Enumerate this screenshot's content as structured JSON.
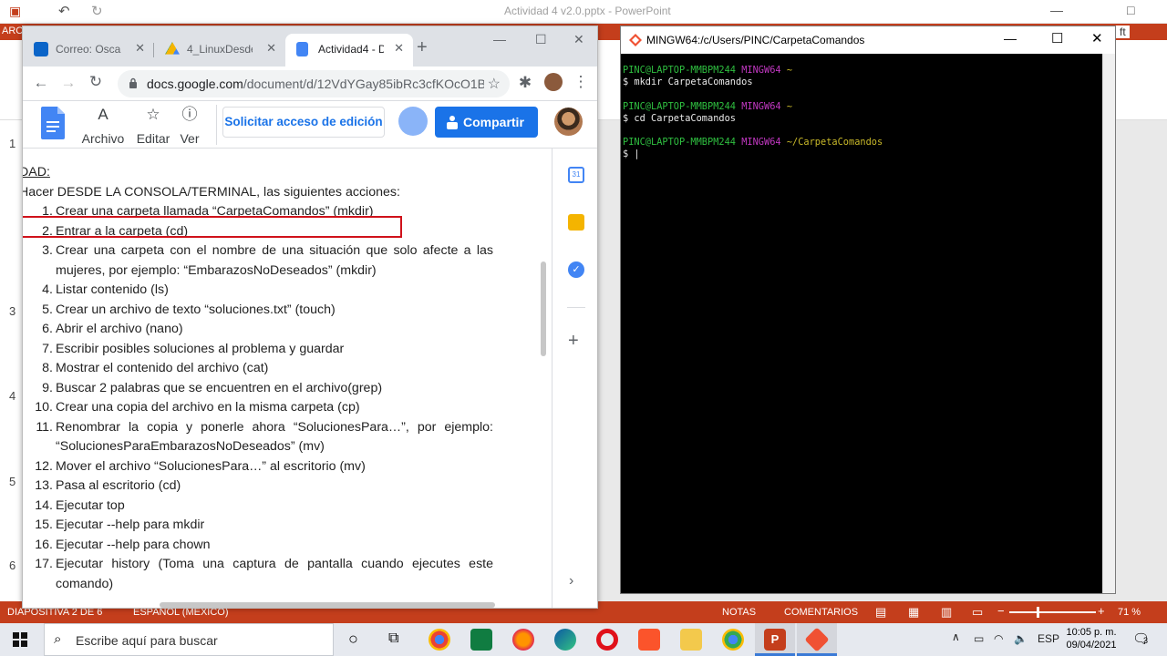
{
  "powerpoint": {
    "title": "Actividad 4 v2.0.pptx  -  PowerPoint",
    "ribbon_tab": "ARC",
    "right_fragment": "ft",
    "slide_numbers": [
      "1",
      "3",
      "4",
      "5",
      "6"
    ],
    "status": {
      "slide": "DIAPOSITIVA 2 DE 6",
      "language": "ESPAÑOL (MÉXICO)",
      "notes": "NOTAS",
      "comments": "COMENTARIOS",
      "zoom": "71 %"
    },
    "colors": {
      "accent": "#c43e1c"
    }
  },
  "chrome": {
    "tabs": [
      {
        "label": "Correo: Oscar S",
        "icon": "outlook-icon",
        "color": "#0a64c8"
      },
      {
        "label": "4_LinuxDesdeLa",
        "icon": "google-drive-icon",
        "color": "#f4b400"
      },
      {
        "label": "Actividad4 - Do",
        "icon": "google-docs-icon",
        "color": "#4285f4"
      }
    ],
    "url_host": "docs.google.com",
    "url_path": "/document/d/12VdYGay85ibRc3cfKOcO1B...",
    "menu": [
      {
        "glyph": "A",
        "label": "Archivo"
      },
      {
        "glyph": "☆",
        "label": "Editar"
      },
      {
        "glyph": "ⓘ",
        "label": "Ver"
      }
    ],
    "request_edit": "Solicitar acceso de edición",
    "share": "Compartir"
  },
  "document": {
    "heading": "DAD:",
    "intro": "Hacer DESDE LA CONSOLA/TERMINAL, las siguientes acciones:",
    "items": [
      {
        "n": "1.",
        "text": "Crear una carpeta llamada “CarpetaComandos” (mkdir)"
      },
      {
        "n": "2.",
        "text": "Entrar a la carpeta (cd)"
      },
      {
        "n": "3.",
        "text": "Crear una carpeta con el nombre de una situación que solo afecte a las mujeres, por ejemplo: “EmbarazosNoDeseados” (mkdir)"
      },
      {
        "n": "4.",
        "text": "Listar contenido (ls)"
      },
      {
        "n": "5.",
        "text": "Crear un archivo de texto “soluciones.txt” (touch)"
      },
      {
        "n": "6.",
        "text": "Abrir el archivo (nano)"
      },
      {
        "n": "7.",
        "text": "Escribir posibles soluciones al problema y guardar"
      },
      {
        "n": "8.",
        "text": "Mostrar el contenido del archivo (cat)"
      },
      {
        "n": "9.",
        "text": "Buscar 2 palabras que se encuentren en el archivo(grep)"
      },
      {
        "n": "10.",
        "text": "Crear una copia del archivo en la misma carpeta (cp)"
      },
      {
        "n": "11.",
        "text": "Renombrar la copia y ponerle ahora “SolucionesPara…”, por ejemplo: “SolucionesParaEmbarazosNoDeseados” (mv)"
      },
      {
        "n": "12.",
        "text": "Mover el archivo “SolucionesPara…” al escritorio (mv)"
      },
      {
        "n": "13.",
        "text": "Pasa al escritorio (cd)"
      },
      {
        "n": "14.",
        "text": "Ejecutar top"
      },
      {
        "n": "15.",
        "text": "Ejecutar --help para mkdir"
      },
      {
        "n": "16.",
        "text": "Ejecutar --help para chown"
      },
      {
        "n": "17.",
        "text": "Ejecutar history (Toma una captura de pantalla cuando ejecutes este comando)"
      }
    ]
  },
  "terminal": {
    "title": "MINGW64:/c/Users/PINC/CarpetaComandos",
    "user": "PINC@LAPTOP-MMBPM244",
    "env": "MINGW64",
    "blocks": [
      {
        "path": "~",
        "cmd": "$ mkdir CarpetaComandos"
      },
      {
        "path": "~",
        "cmd": "$ cd CarpetaComandos"
      },
      {
        "path": "~/CarpetaComandos",
        "cmd": "$ "
      }
    ]
  },
  "taskbar": {
    "search_placeholder": "Escribe aquí para buscar",
    "language": "ESP",
    "time": "10:05 p. m.",
    "date": "09/04/2021",
    "notifications": "3"
  }
}
